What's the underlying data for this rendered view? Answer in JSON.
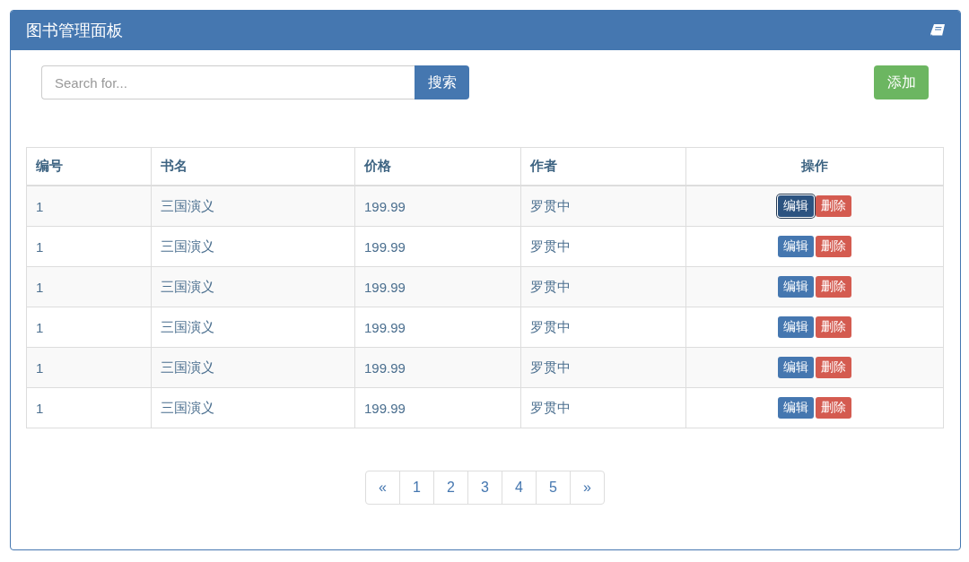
{
  "panel": {
    "title": "图书管理面板"
  },
  "search": {
    "placeholder": "Search for...",
    "button": "搜索"
  },
  "add_button": "添加",
  "table": {
    "columns": [
      "编号",
      "书名",
      "价格",
      "作者",
      "操作"
    ],
    "rows": [
      {
        "cells": [
          "1",
          "三国演义",
          "199.99",
          "罗贯中"
        ],
        "edit": "编辑",
        "delete": "删除",
        "edit_focused": true
      },
      {
        "cells": [
          "1",
          "三国演义",
          "199.99",
          "罗贯中"
        ],
        "edit": "编辑",
        "delete": "删除",
        "edit_focused": false
      },
      {
        "cells": [
          "1",
          "三国演义",
          "199.99",
          "罗贯中"
        ],
        "edit": "编辑",
        "delete": "删除",
        "edit_focused": false
      },
      {
        "cells": [
          "1",
          "三国演义",
          "199.99",
          "罗贯中"
        ],
        "edit": "编辑",
        "delete": "删除",
        "edit_focused": false
      },
      {
        "cells": [
          "1",
          "三国演义",
          "199.99",
          "罗贯中"
        ],
        "edit": "编辑",
        "delete": "删除",
        "edit_focused": false
      },
      {
        "cells": [
          "1",
          "三国演义",
          "199.99",
          "罗贯中"
        ],
        "edit": "编辑",
        "delete": "删除",
        "edit_focused": false
      }
    ]
  },
  "pagination": [
    "«",
    "1",
    "2",
    "3",
    "4",
    "5",
    "»"
  ]
}
